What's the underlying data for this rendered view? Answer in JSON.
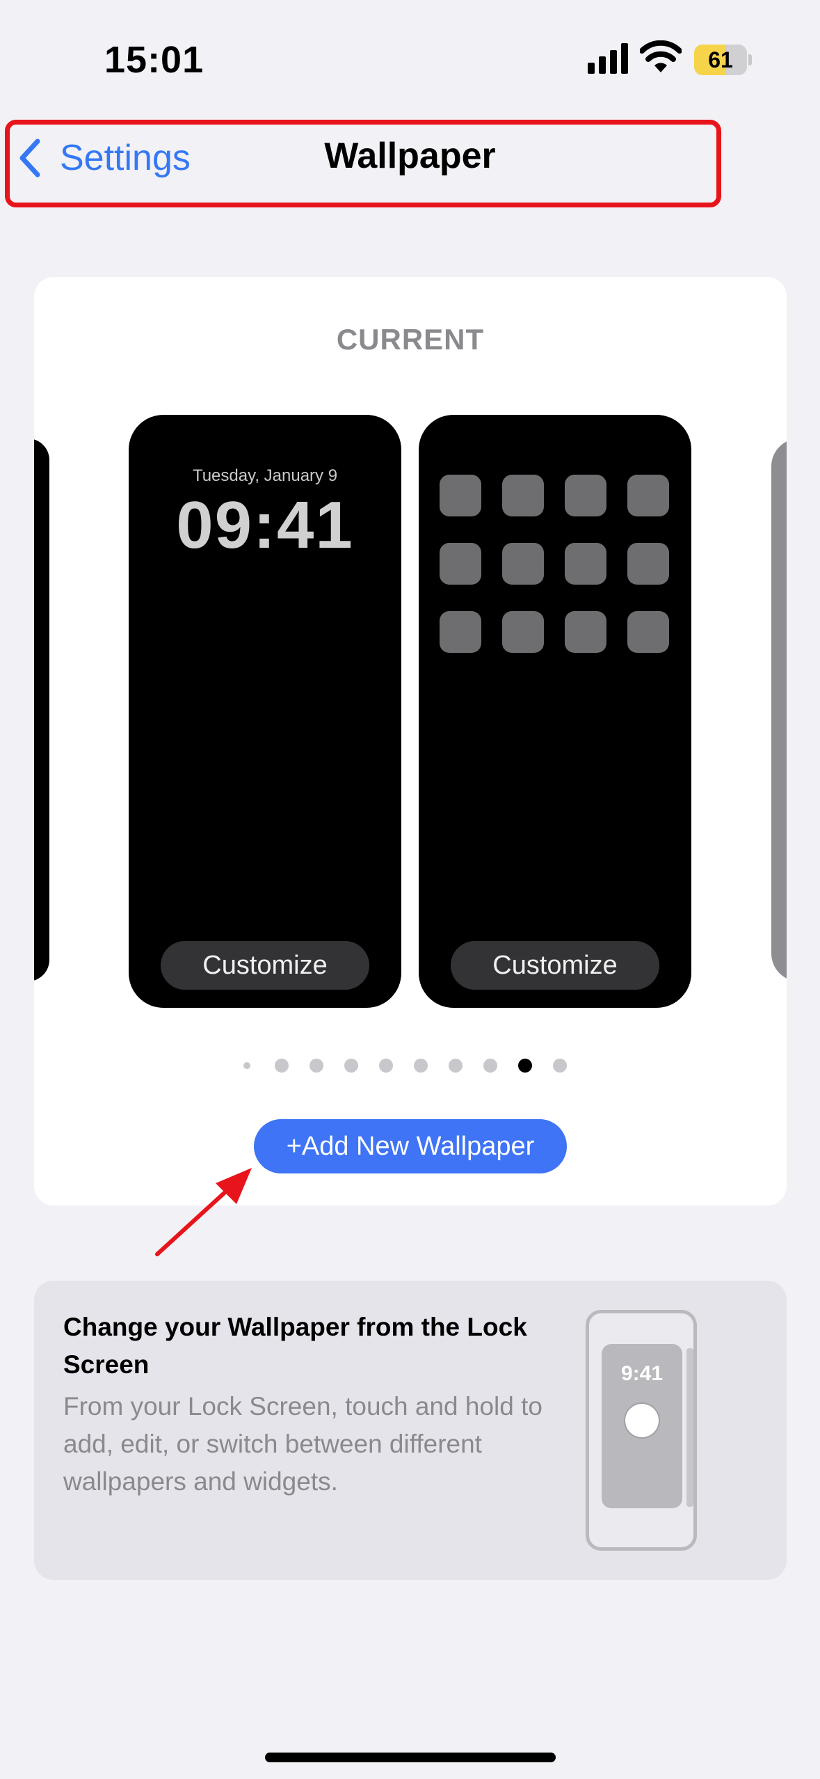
{
  "status_bar": {
    "time": "15:01",
    "battery_level": "61",
    "battery_fraction": 0.61,
    "icons": [
      "cellular-signal-icon",
      "wifi-icon",
      "battery-icon"
    ]
  },
  "nav": {
    "back_label": "Settings",
    "title": "Wallpaper"
  },
  "current_card": {
    "section_label": "CURRENT",
    "lock_screen": {
      "date": "Tuesday, January 9",
      "time": "09:41",
      "customize_label": "Customize"
    },
    "home_screen": {
      "customize_label": "Customize",
      "app_tile_count": 12
    },
    "page_dots": {
      "count": 10,
      "active_index": 8
    },
    "add_button_label": "+Add New Wallpaper"
  },
  "info_card": {
    "title": "Change your Wallpaper from the Lock Screen",
    "body": "From your Lock Screen, touch and hold to add, edit, or switch between different wallpapers and widgets.",
    "illustration_time": "9:41"
  },
  "colors": {
    "accent": "#3478f6",
    "add_button": "#3e74f5",
    "annotation_red": "#e8141b",
    "battery_fill": "#f5d44a"
  }
}
